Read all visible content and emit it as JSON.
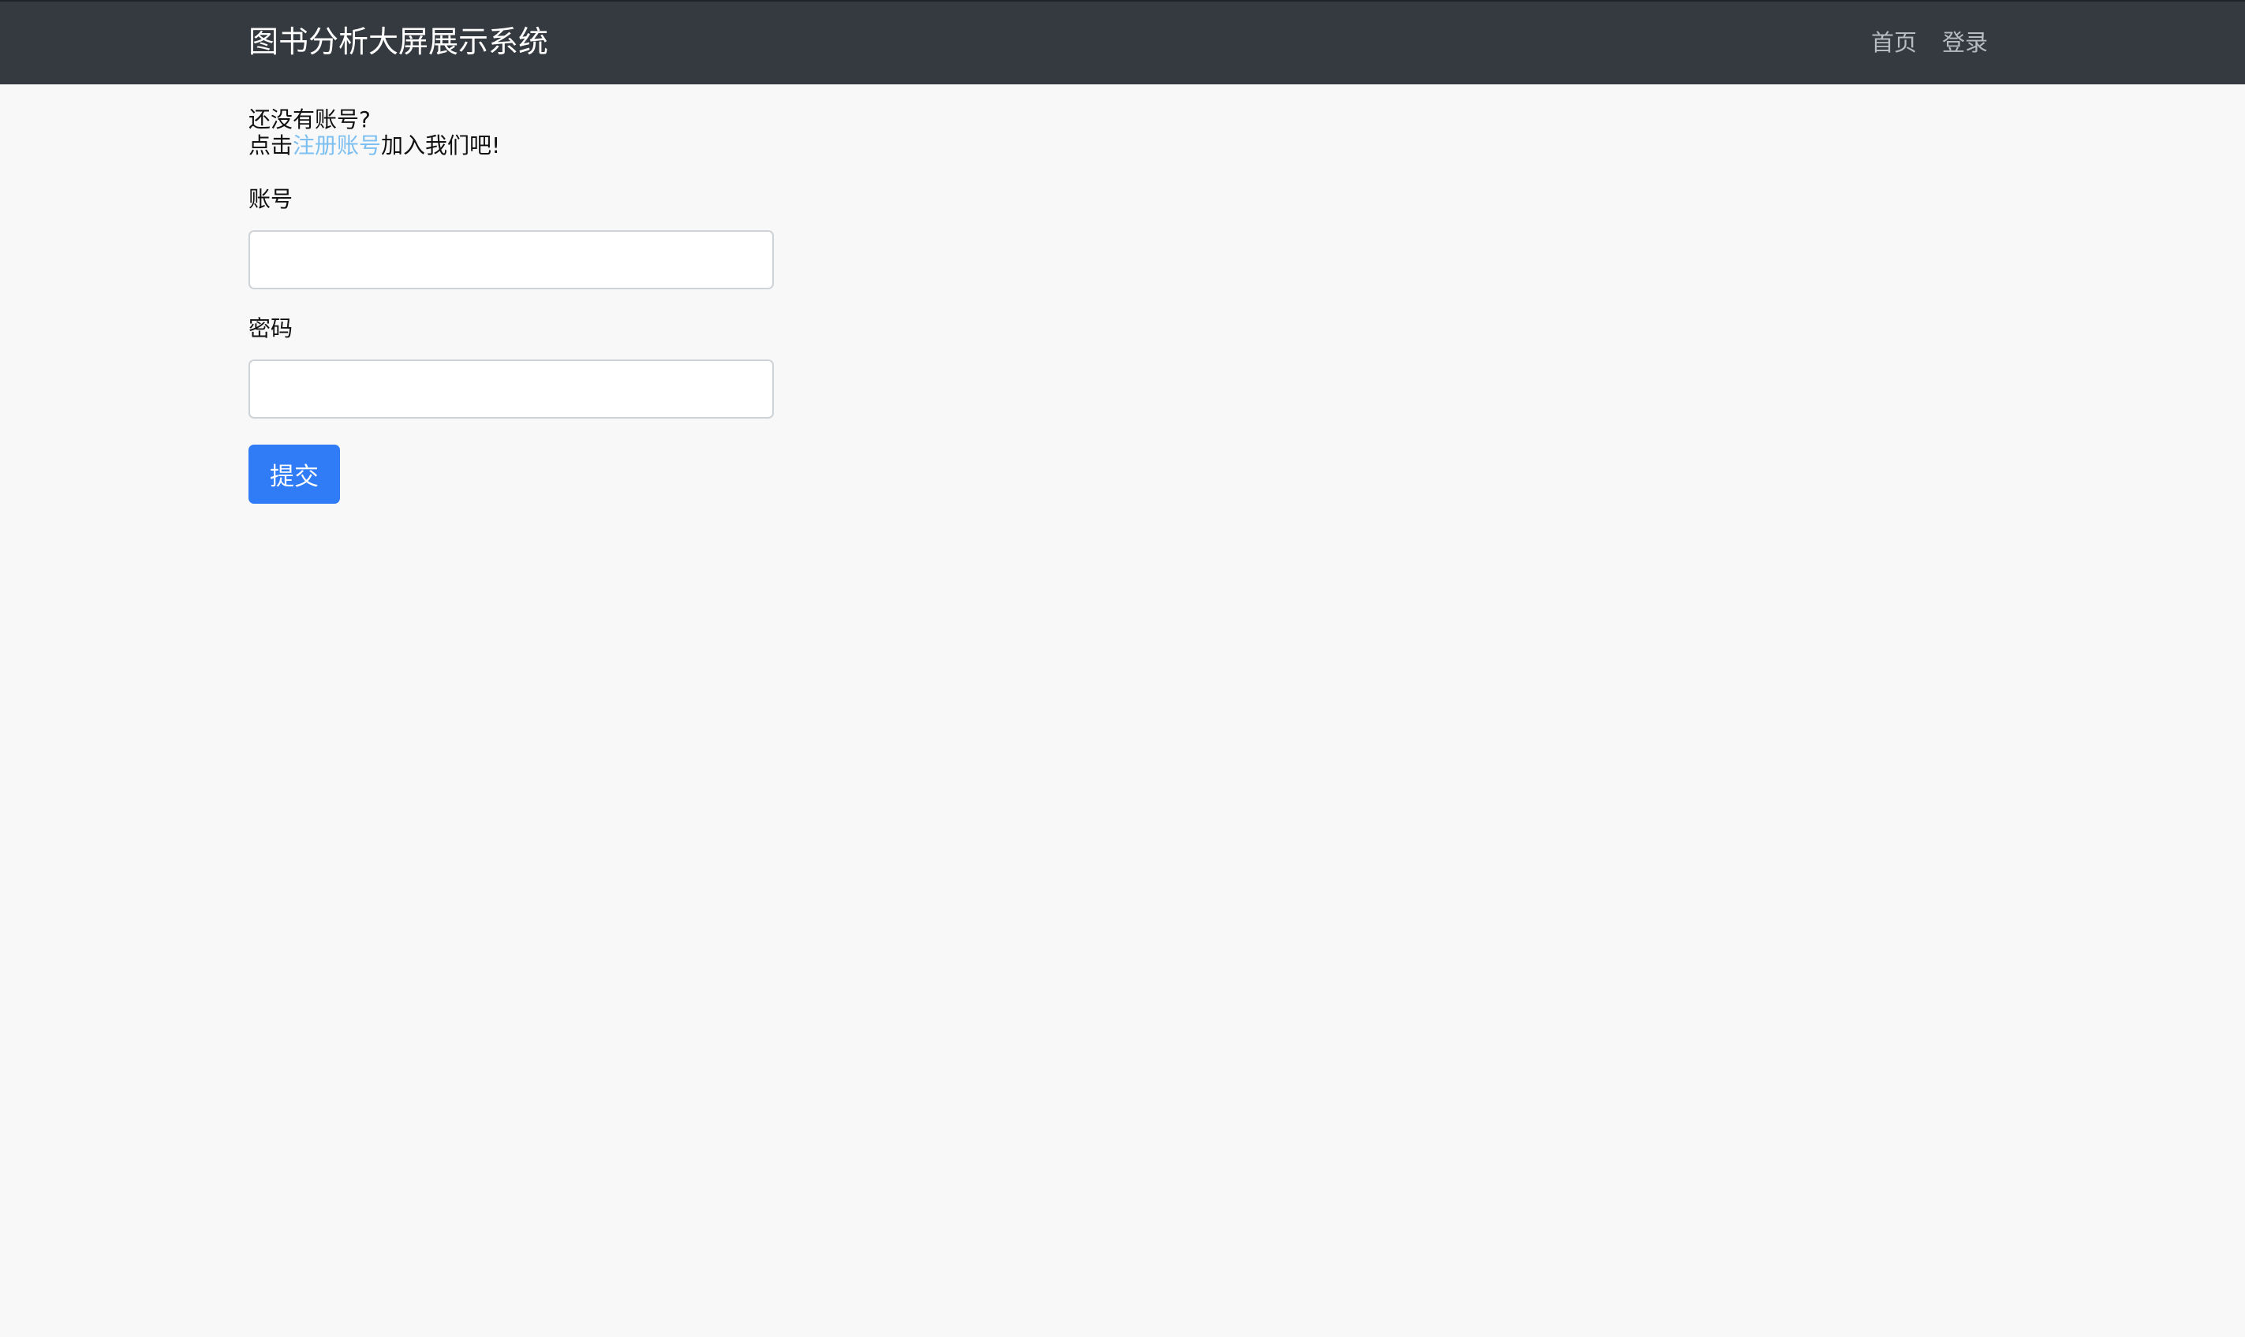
{
  "navbar": {
    "brand": "图书分析大屏展示系统",
    "links": [
      {
        "label": "首页"
      },
      {
        "label": "登录"
      }
    ]
  },
  "login": {
    "prompt_line1": "还没有账号?",
    "prompt_prefix": "点击",
    "register_link": "注册账号",
    "prompt_suffix": "加入我们吧!",
    "username_label": "账号",
    "username_value": "",
    "password_label": "密码",
    "password_value": "",
    "submit_label": "提交"
  },
  "colors": {
    "navbar_bg": "#343a40",
    "page_bg": "#f9f8f8",
    "link": "#7cbff0",
    "primary_button": "#2f7cf6"
  }
}
